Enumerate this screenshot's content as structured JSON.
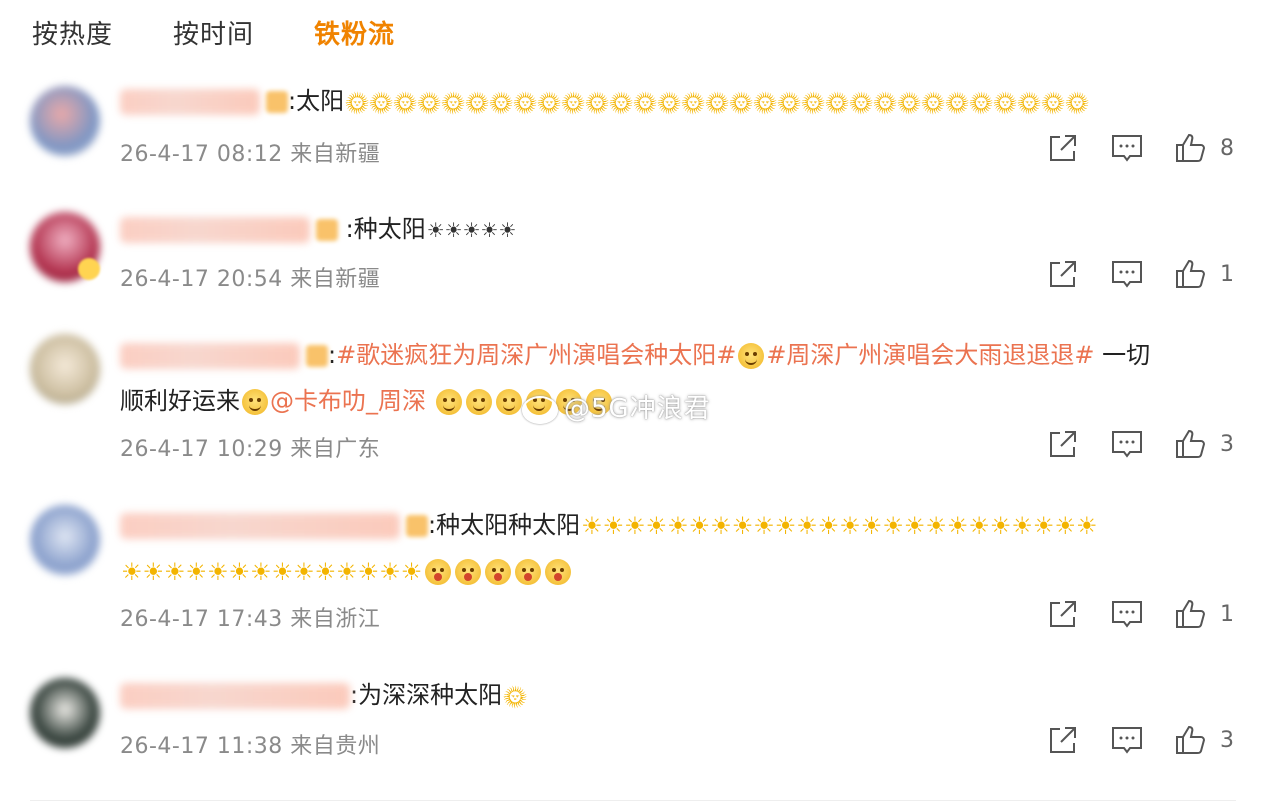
{
  "tabs": [
    {
      "label": "按热度",
      "active": false
    },
    {
      "label": "按时间",
      "active": false
    },
    {
      "label": "铁粉流",
      "active": true
    }
  ],
  "accent_color": "#f08300",
  "topic_color": "#eb7350",
  "comments": [
    {
      "text_parts": [
        ":太阳"
      ],
      "emoji": "sun-face x31",
      "time": "26-4-17 08:12",
      "location": "来自新疆",
      "likes": "8"
    },
    {
      "text_parts": [
        ":种太阳"
      ],
      "emoji": "black-sun x5",
      "time": "26-4-17 20:54",
      "location": "来自新疆",
      "likes": "1"
    },
    {
      "text_parts": [
        ":",
        "#歌迷疯狂为周深广州演唱会种太阳#",
        "#周深广州演唱会大雨退退退#",
        " 一切",
        "顺利好运来",
        "@卡布叻_周深"
      ],
      "emoji": "smile-face",
      "time": "26-4-17 10:29",
      "location": "来自广东",
      "likes": "3"
    },
    {
      "text_parts": [
        ":种太阳种太阳"
      ],
      "emoji": "sun x38, excited-face x5",
      "time": "26-4-17 17:43",
      "location": "来自浙江",
      "likes": "1"
    },
    {
      "text_parts": [
        ":为深深种太阳"
      ],
      "emoji": "sun-face x1",
      "time": "26-4-17 11:38",
      "location": "来自贵州",
      "likes": "3"
    }
  ],
  "watermark": "@5G冲浪君",
  "icons": {
    "share": "share-icon",
    "comment": "comment-icon",
    "like": "like-icon"
  }
}
